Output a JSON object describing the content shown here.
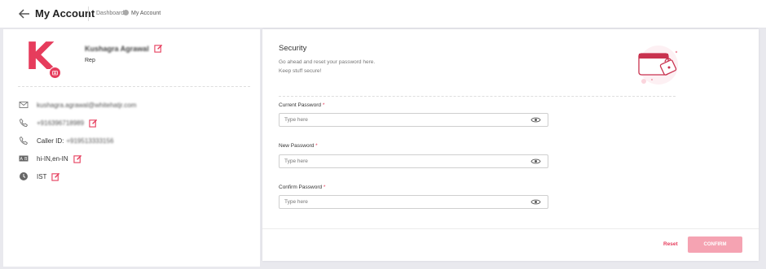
{
  "header": {
    "title": "My Account",
    "breadcrumb": [
      "Dashboard",
      "My Account"
    ]
  },
  "profile": {
    "avatar_letter": "K",
    "name": "Kushagra Agrawal",
    "role": "Rep",
    "email": "kushagra.agrawal@whitehatjr.com",
    "phone": "+916396718989",
    "caller_id_label": "Caller ID:",
    "caller_id_value": "+919513333156",
    "languages": "hi-IN,en-IN",
    "timezone": "IST"
  },
  "security": {
    "title": "Security",
    "description_line1": "Go ahead and reset your password here.",
    "description_line2": "Keep stuff secure!",
    "fields": [
      {
        "label": "Current Password",
        "required": "*",
        "placeholder": "Type here"
      },
      {
        "label": "New Password",
        "required": "*",
        "placeholder": "Type here"
      },
      {
        "label": "Confirm Password",
        "required": "*",
        "placeholder": "Type here"
      }
    ],
    "reset_label": "Reset",
    "confirm_label": "CONFIRM"
  },
  "colors": {
    "accent": "#e63c5c",
    "confirm_disabled": "#f5a3b2"
  }
}
